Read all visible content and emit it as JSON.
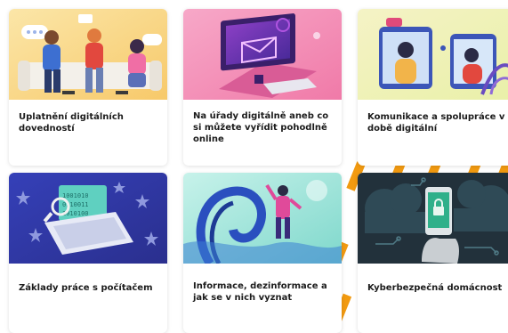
{
  "courses": [
    {
      "title": "Uplatnění  digitálních dovedností",
      "illustration": "people-on-sofa-icon"
    },
    {
      "title": "Na úřady digitálně aneb co si můžete vyřídit pohodlně online",
      "illustration": "computer-email-icon"
    },
    {
      "title": "Komunikace a spolupráce v době digitální",
      "illustration": "video-call-icon"
    },
    {
      "title": "Základy práce s počítačem",
      "illustration": "laptop-eu-stars-icon"
    },
    {
      "title": "Informace, dezinformace a jak se v nich vyznat",
      "illustration": "person-in-wave-icon"
    },
    {
      "title": "Kyberbezpečná domácnost",
      "illustration": "smartphone-lock-icon"
    }
  ],
  "colors": {
    "accent_stripe": "#f29a10",
    "title_text": "#1c1c1c",
    "card_bg": "#ffffff"
  }
}
